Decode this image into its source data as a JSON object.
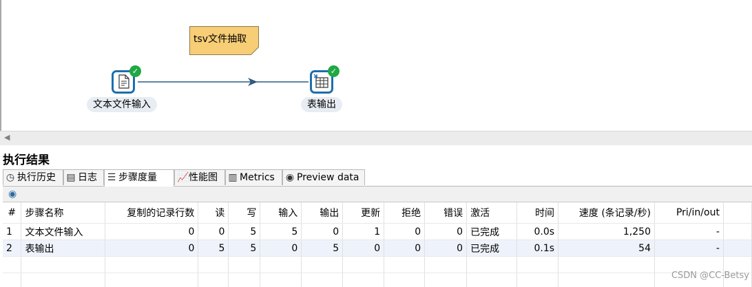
{
  "canvas": {
    "note": "tsv文件抽取",
    "steps": [
      {
        "label": "文本文件输入",
        "status": "ok"
      },
      {
        "label": "表输出",
        "status": "ok"
      }
    ]
  },
  "results": {
    "title": "执行结果",
    "tabs": [
      {
        "label": "执行历史",
        "icon": "clock-icon"
      },
      {
        "label": "日志",
        "icon": "log-icon"
      },
      {
        "label": "步骤度量",
        "icon": "metrics-list-icon",
        "active": true
      },
      {
        "label": "性能图",
        "icon": "performance-chart-icon"
      },
      {
        "label": "Metrics",
        "icon": "metrics-icon"
      },
      {
        "label": "Preview data",
        "icon": "eye-icon"
      }
    ],
    "columns": [
      "#",
      "步骤名称",
      "复制的记录行数",
      "读",
      "写",
      "输入",
      "输出",
      "更新",
      "拒绝",
      "错误",
      "激活",
      "时间",
      "速度 (条记录/秒)",
      "Pri/in/out"
    ],
    "rows": [
      [
        "1",
        "文本文件输入",
        "0",
        "0",
        "5",
        "5",
        "0",
        "1",
        "0",
        "0",
        "已完成",
        "0.0s",
        "1,250",
        "-"
      ],
      [
        "2",
        "表输出",
        "0",
        "5",
        "5",
        "0",
        "5",
        "0",
        "0",
        "0",
        "已完成",
        "0.1s",
        "54",
        "-"
      ]
    ]
  },
  "watermark": "CSDN @CC-Betsy",
  "colors": {
    "hop": "#2f5a7e",
    "stepBorder": "#1c6eb0",
    "ok": "#1fa844",
    "note": "#f7cd76"
  }
}
